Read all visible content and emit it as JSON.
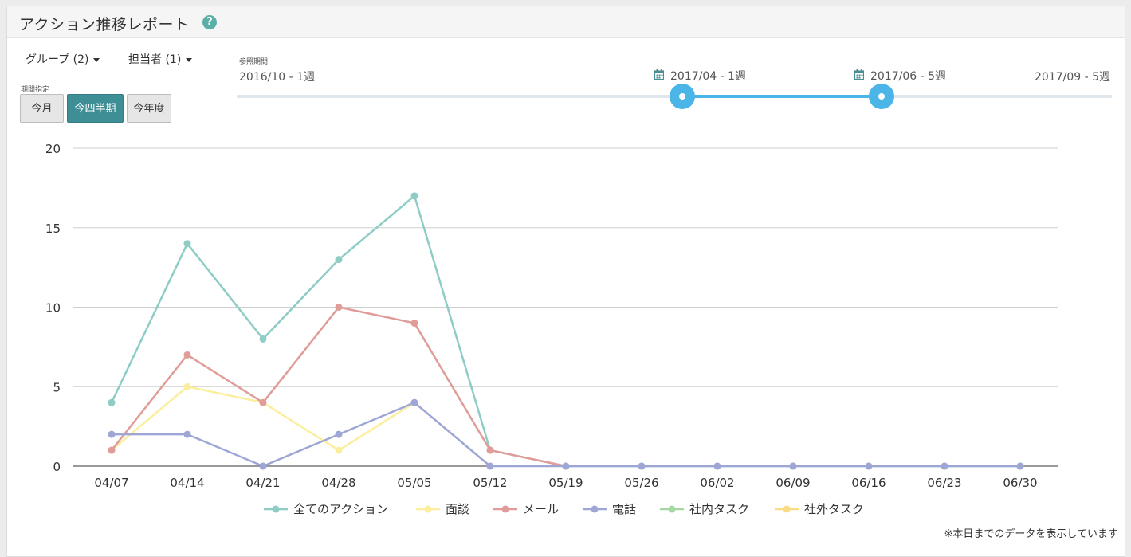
{
  "header": {
    "title": "アクション推移レポート",
    "help_icon": "?"
  },
  "filters": {
    "group_label": "グループ (2)",
    "assignee_label": "担当者 (1)"
  },
  "period": {
    "label": "期間指定",
    "buttons": [
      {
        "label": "今月",
        "active": false
      },
      {
        "label": "今四半期",
        "active": true
      },
      {
        "label": "今年度",
        "active": false
      }
    ]
  },
  "range": {
    "label": "参照期間",
    "min": "2016/10 - 1週",
    "max": "2017/09 - 5週",
    "start": "2017/04 - 1週",
    "end": "2017/06 - 5週",
    "accent": "#4ab5e6"
  },
  "chart_data": {
    "type": "line",
    "categories": [
      "04/07",
      "04/14",
      "04/21",
      "04/28",
      "05/05",
      "05/12",
      "05/19",
      "05/26",
      "06/02",
      "06/09",
      "06/16",
      "06/23",
      "06/30"
    ],
    "ylim": [
      0,
      20
    ],
    "yticks": [
      "0",
      "5",
      "10",
      "15",
      "20"
    ],
    "grid": true,
    "legend_position": "bottom",
    "series": [
      {
        "name": "全てのアクション",
        "color": "#8ecdc5",
        "values": [
          4,
          14,
          8,
          13,
          17,
          1,
          0,
          0,
          0,
          0,
          0,
          0,
          0
        ]
      },
      {
        "name": "面談",
        "color": "#fbee9c",
        "values": [
          1,
          5,
          4,
          1,
          4,
          null,
          null,
          null,
          null,
          null,
          null,
          null,
          null
        ]
      },
      {
        "name": "メール",
        "color": "#e09c98",
        "values": [
          1,
          7,
          4,
          10,
          9,
          1,
          0,
          null,
          null,
          null,
          null,
          null,
          null
        ]
      },
      {
        "name": "電話",
        "color": "#9ea6d6",
        "values": [
          2,
          2,
          0,
          2,
          4,
          0,
          0,
          0,
          0,
          0,
          0,
          0,
          0
        ]
      },
      {
        "name": "社内タスク",
        "color": "#a7d8a3",
        "values": []
      },
      {
        "name": "社外タスク",
        "color": "#f9dd84",
        "values": []
      }
    ]
  },
  "footer": {
    "note": "※本日までのデータを表示しています"
  }
}
